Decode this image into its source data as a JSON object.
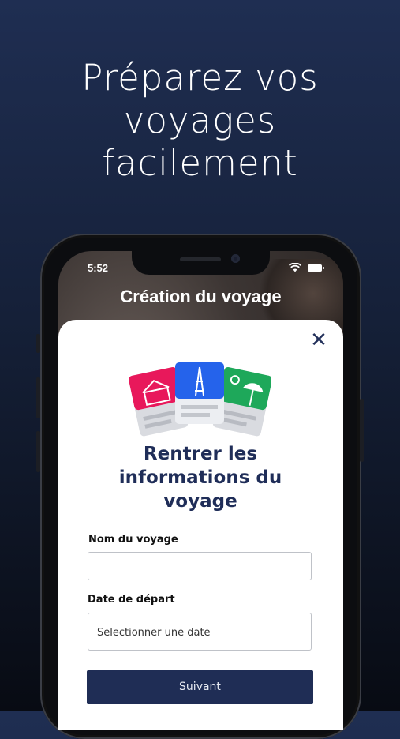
{
  "headline": [
    "Préparez vos",
    "voyages",
    "facilement"
  ],
  "status_bar": {
    "time": "5:52"
  },
  "screen": {
    "title": "Création du voyage",
    "close_icon": "close-icon"
  },
  "form": {
    "title_lines": [
      "Rentrer les",
      "informations du",
      "voyage"
    ],
    "trip_name_label": "Nom du voyage",
    "trip_name_value": "",
    "departure_label": "Date de départ",
    "departure_placeholder": "Selectionner une date",
    "next_label": "Suivant"
  },
  "colors": {
    "primary": "#1f2d55",
    "card_pink": "#e8185b",
    "card_blue": "#2563eb",
    "card_green": "#1ea85a"
  }
}
